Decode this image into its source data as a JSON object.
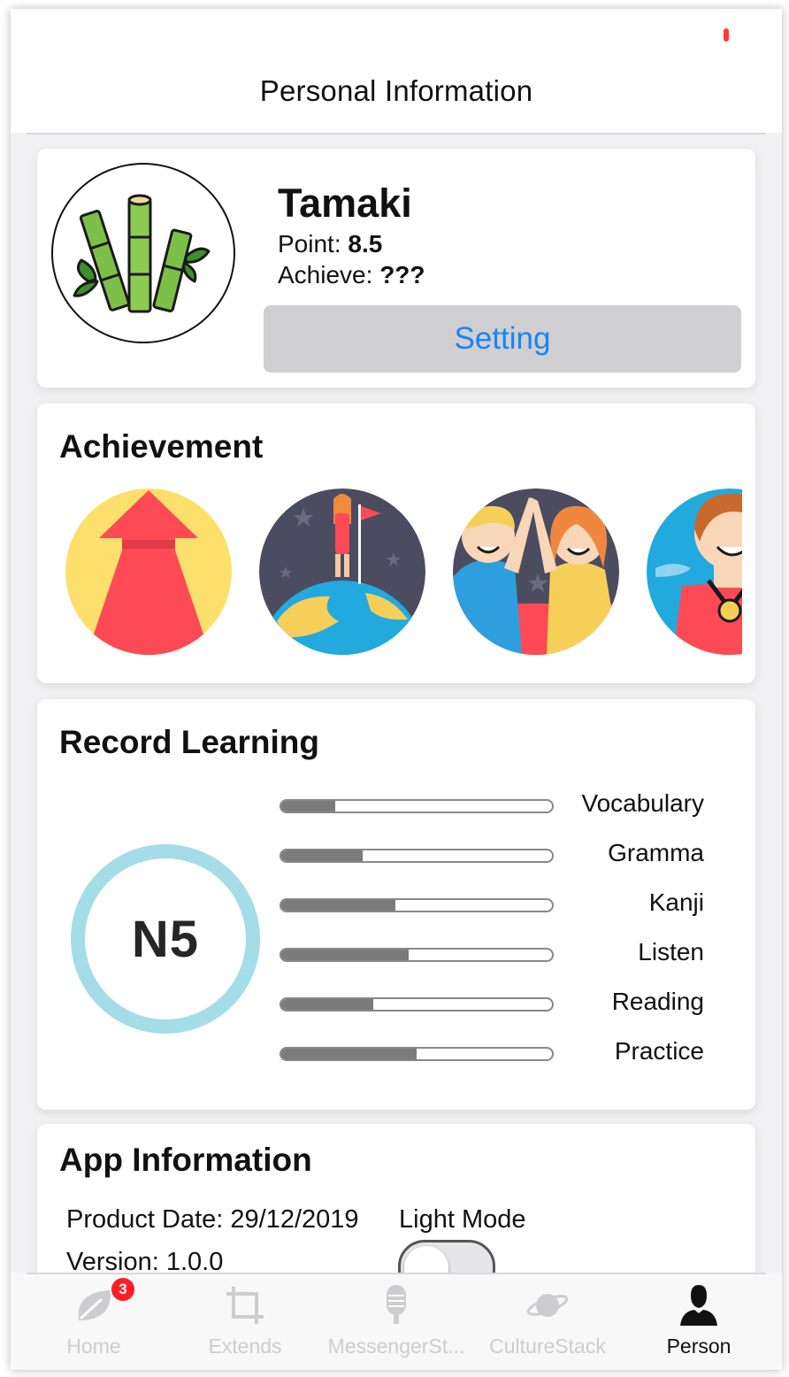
{
  "navigation": {
    "title": "Personal Information"
  },
  "profile": {
    "name": "Tamaki",
    "point_label": "Point:",
    "point_value": "8.5",
    "achieve_label": "Achieve:",
    "achieve_value": "???",
    "setting_label": "Setting",
    "avatar_icon": "bamboo-icon"
  },
  "achievement": {
    "title": "Achievement",
    "badges": [
      "arrow-up-badge",
      "flag-on-globe-badge",
      "high-five-badge",
      "medal-winner-badge"
    ]
  },
  "record": {
    "title": "Record Learning",
    "level": "N5",
    "skills": [
      {
        "label": "Vocabulary",
        "progress": 0.2
      },
      {
        "label": "Gramma",
        "progress": 0.3
      },
      {
        "label": "Kanji",
        "progress": 0.42
      },
      {
        "label": "Listen",
        "progress": 0.47
      },
      {
        "label": "Reading",
        "progress": 0.34
      },
      {
        "label": "Practice",
        "progress": 0.5
      }
    ]
  },
  "app_info": {
    "title": "App Information",
    "product_date": "Product Date: 29/12/2019",
    "version": "Version: 1.0.0",
    "mode_label": "Light Mode",
    "light_mode_on": false
  },
  "tabbar": {
    "tabs": [
      {
        "label": "Home",
        "icon": "leaf-icon",
        "badge": "3"
      },
      {
        "label": "Extends",
        "icon": "crop-icon"
      },
      {
        "label": "MessengerSt...",
        "icon": "microphone-icon"
      },
      {
        "label": "CultureStack",
        "icon": "planet-icon"
      },
      {
        "label": "Person",
        "icon": "person-icon"
      }
    ],
    "active": "Person"
  },
  "colors": {
    "accent": "#1a84f5",
    "level_ring": "#a4dde8",
    "progress_fill": "#7b7b7b",
    "badge_red": "#ff1d25",
    "status_dot": "#ff3b30"
  }
}
